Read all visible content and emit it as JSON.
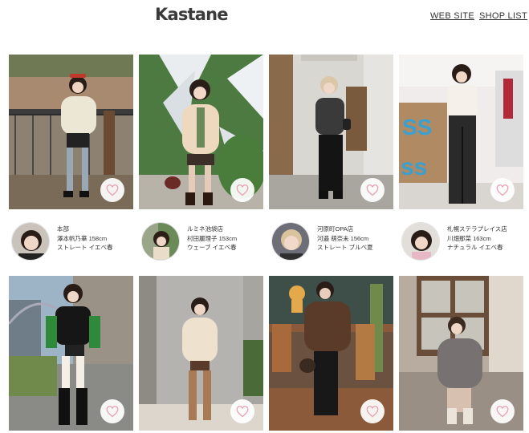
{
  "header": {
    "logo": "Kastane",
    "nav_web": "WEB SITE",
    "nav_shop": "SHOP LIST"
  },
  "icons": {
    "like": "heart-outline-icon"
  },
  "colors": {
    "heart_stroke": "#e7a3b3",
    "text": "#333333"
  },
  "posts": [
    {
      "store": "本部",
      "staff": "澤本帆乃華 158cm",
      "tags": "ストレート イエベ春"
    },
    {
      "store": "ルミネ池袋店",
      "staff": "村田麗理子 153cm",
      "tags": "ウェーブ イエベ春"
    },
    {
      "store": "河原町OPA店",
      "staff": "河邉 萌奈未 156cm",
      "tags": "ストレート ブルベ夏"
    },
    {
      "store": "札幌ステラプレイス店",
      "staff": "川畑那菜 163cm",
      "tags": "ナチュラル イエベ春"
    },
    {
      "store": "",
      "staff": "",
      "tags": ""
    },
    {
      "store": "",
      "staff": "",
      "tags": ""
    },
    {
      "store": "",
      "staff": "",
      "tags": ""
    },
    {
      "store": "",
      "staff": "",
      "tags": ""
    }
  ]
}
